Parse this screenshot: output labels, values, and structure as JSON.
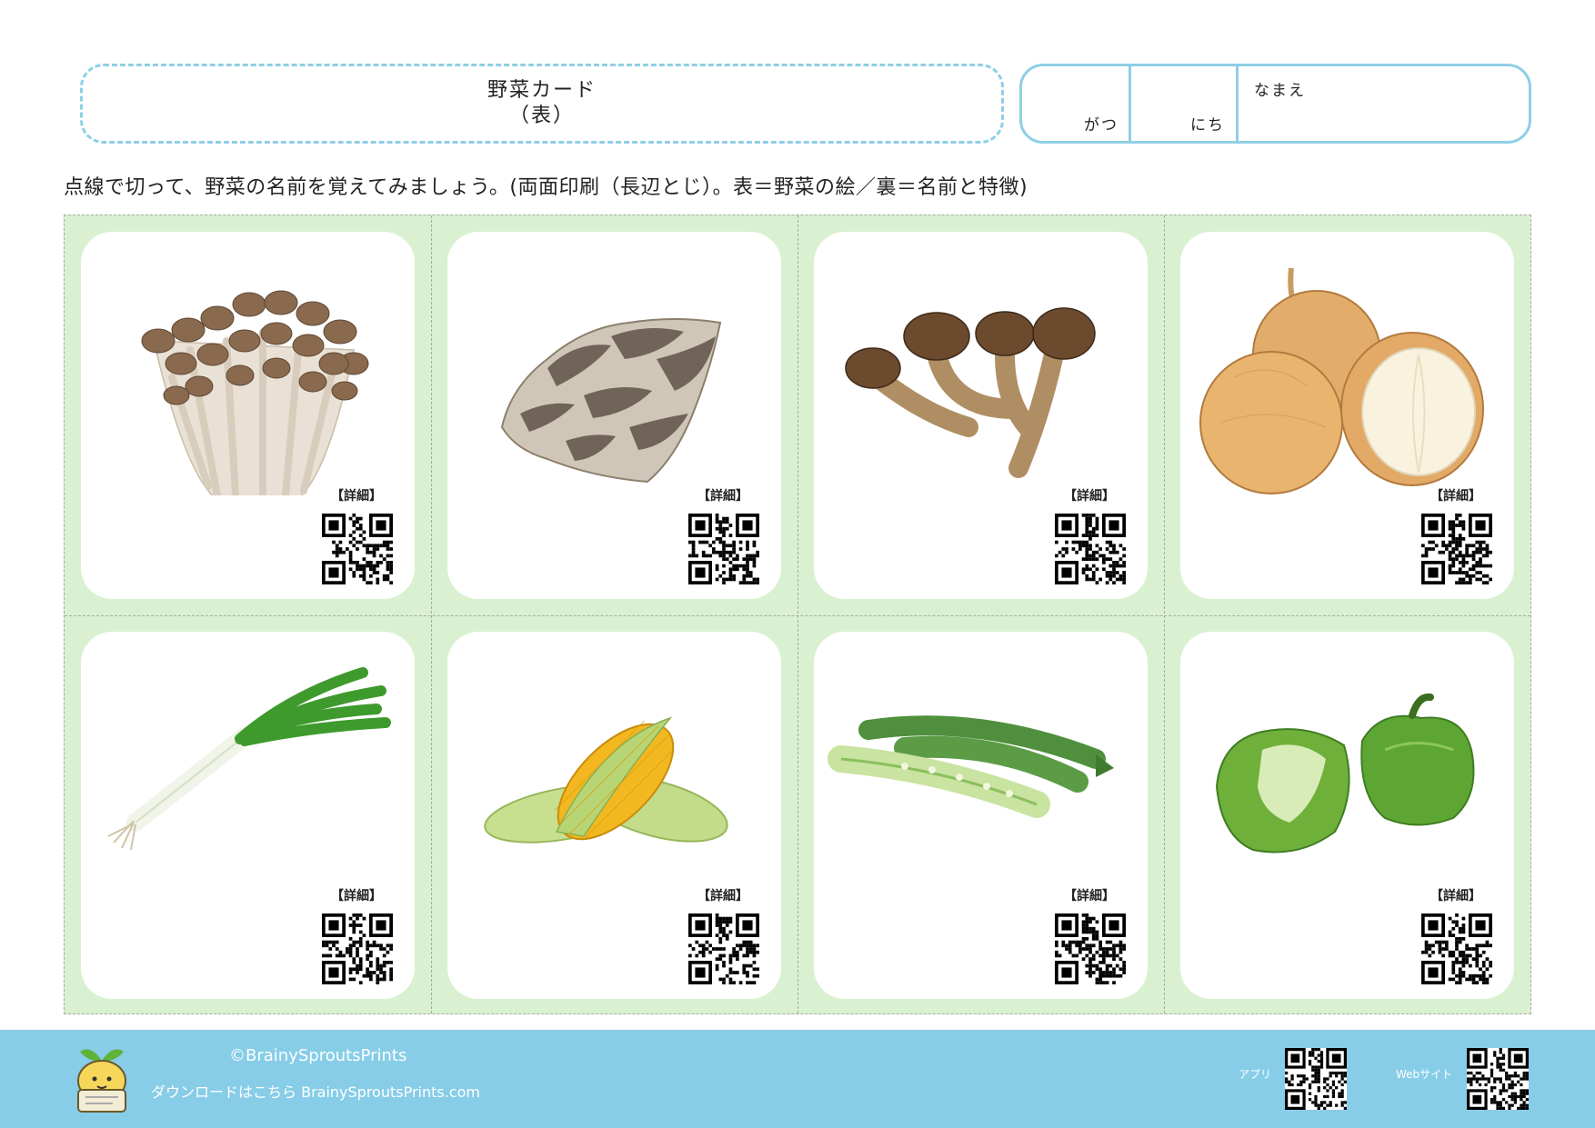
{
  "header": {
    "title": "野菜カード",
    "subtitle": "（表）"
  },
  "date_box": {
    "month_label": "がつ",
    "day_label": "にち",
    "name_label": "なまえ"
  },
  "instructions": "点線で切って、野菜の名前を覚えてみましょう。(両面印刷（長辺とじ）。表＝野菜の絵／裏＝名前と特徴)",
  "cards": [
    {
      "image": "shimeji-mushroom",
      "detail_label": "【詳細】"
    },
    {
      "image": "maitake-mushroom",
      "detail_label": "【詳細】"
    },
    {
      "image": "matsutake-mushroom",
      "detail_label": "【詳細】"
    },
    {
      "image": "onion",
      "detail_label": "【詳細】"
    },
    {
      "image": "green-onion",
      "detail_label": "【詳細】"
    },
    {
      "image": "corn",
      "detail_label": "【詳細】"
    },
    {
      "image": "okra",
      "detail_label": "【詳細】"
    },
    {
      "image": "green-pepper",
      "detail_label": "【詳細】"
    }
  ],
  "footer": {
    "copyright": "©BrainySproutsPrints",
    "download": "ダウンロードはこちら BrainySproutsPrints.com",
    "app_label": "アプリ",
    "web_label": "Webサイト"
  },
  "colors": {
    "accent": "#8ecfe6",
    "grid_bg": "#d9f1d0",
    "footer_bg": "#87cde8"
  }
}
